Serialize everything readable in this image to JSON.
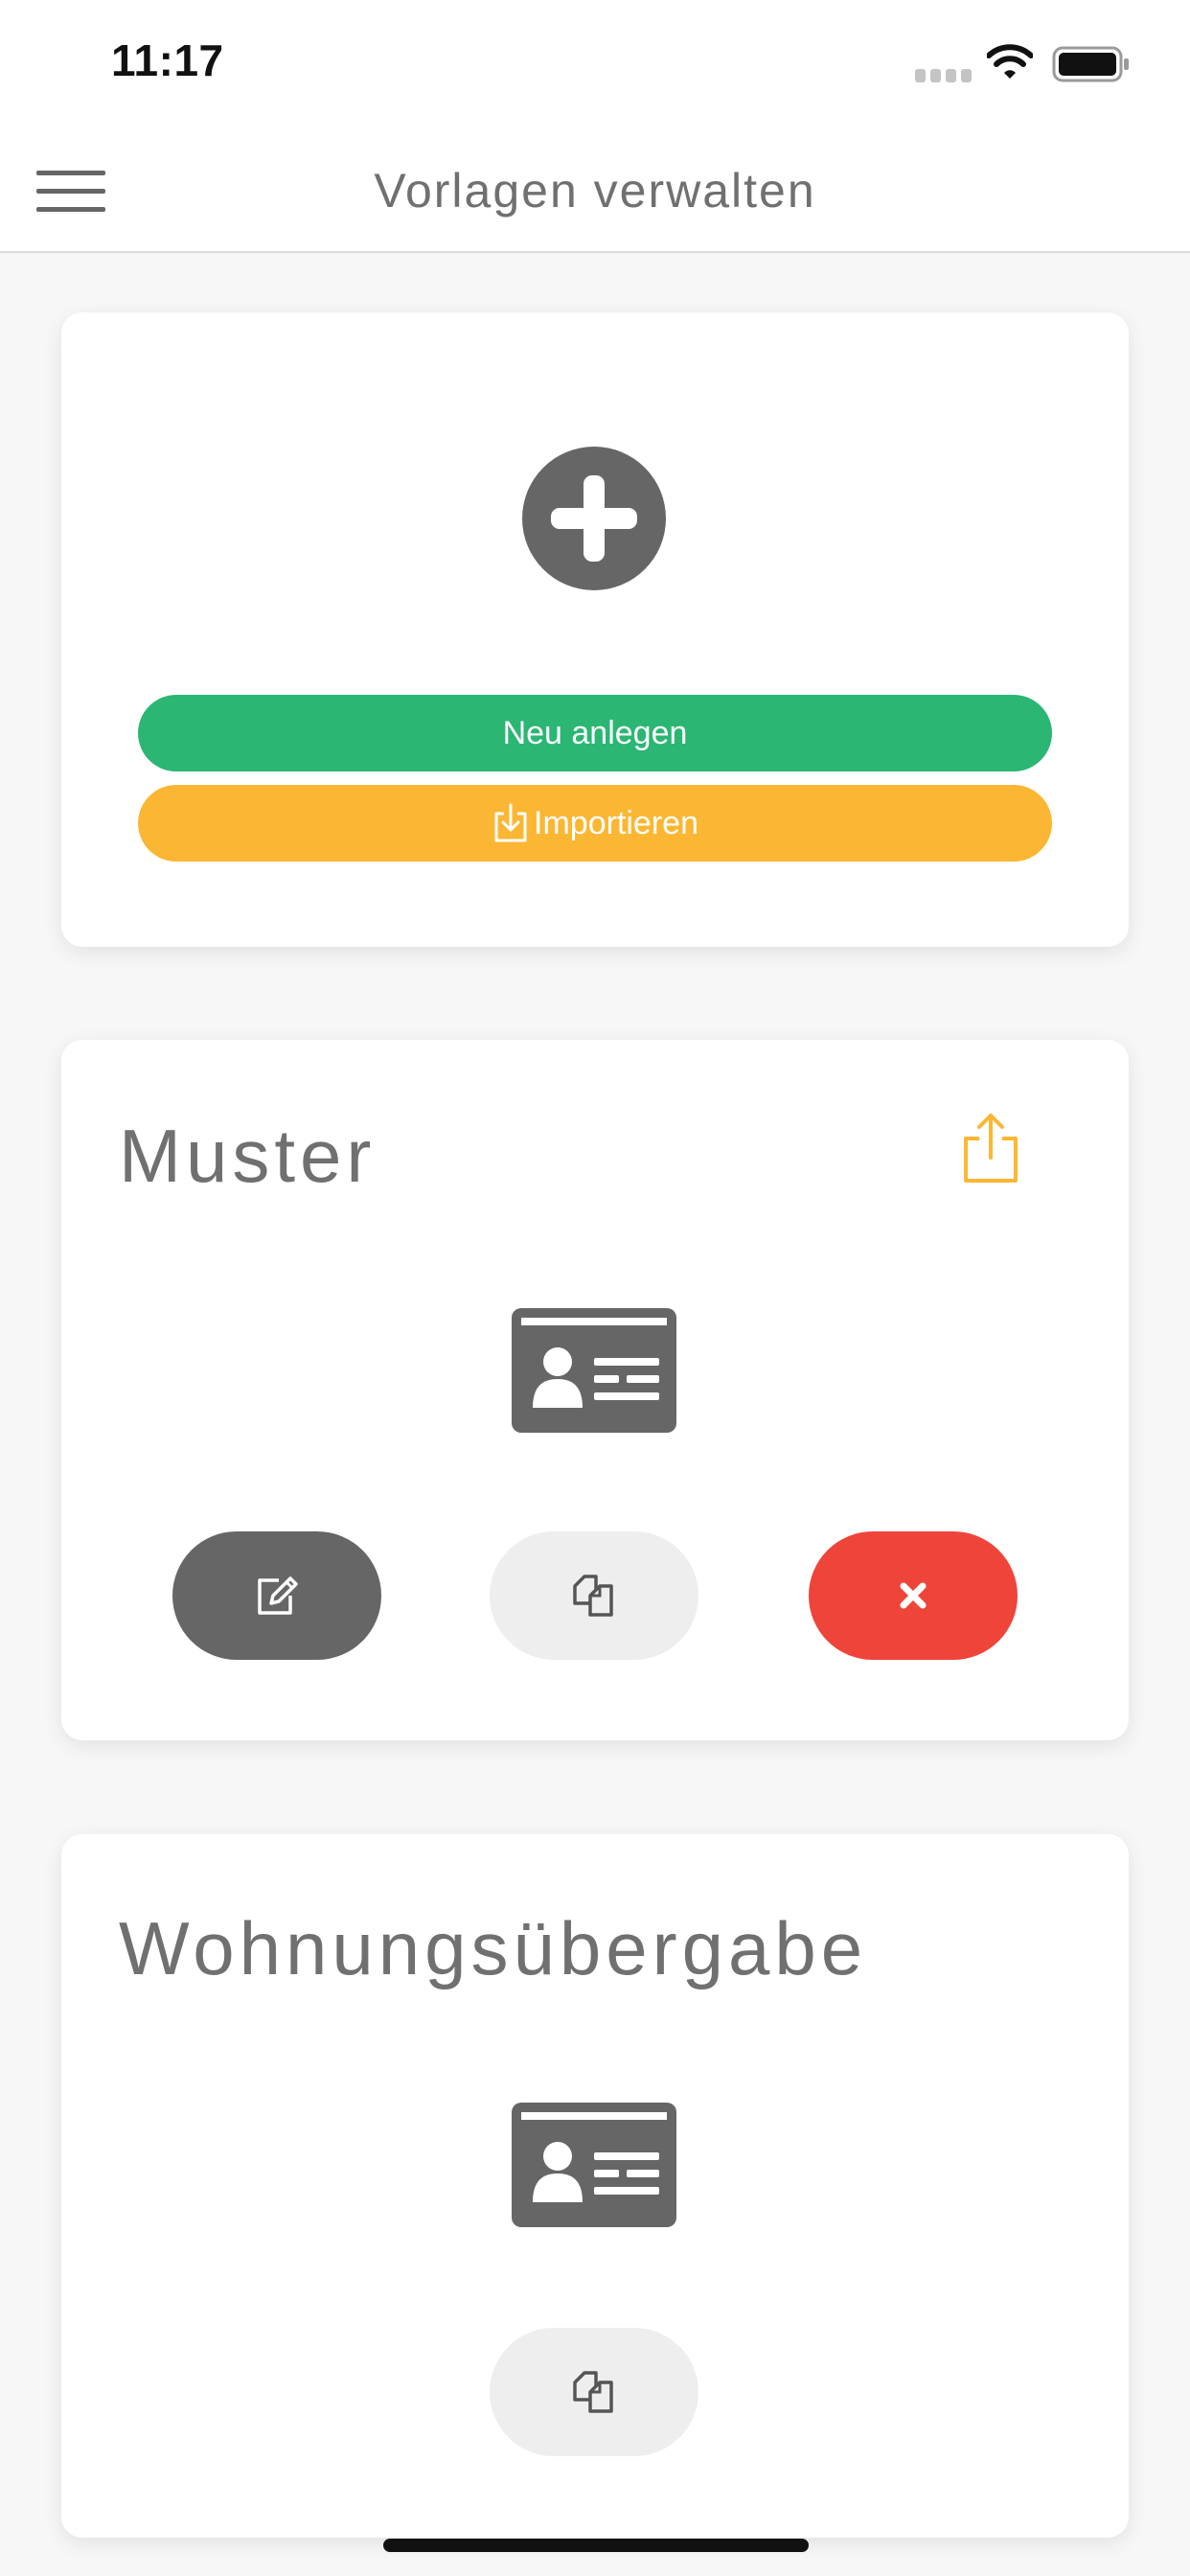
{
  "status_bar": {
    "time": "11:17"
  },
  "nav": {
    "title": "Vorlagen verwalten",
    "menu_icon": "hamburger-menu-icon"
  },
  "new_template": {
    "icon": "plus-circle-icon",
    "create_label": "Neu anlegen",
    "import_label": "Importieren",
    "import_icon": "import-download-icon"
  },
  "templates": [
    {
      "title": "Muster",
      "icon": "id-card-icon",
      "share_icon": "share-icon",
      "actions": [
        "edit-icon",
        "copy-icon",
        "delete-icon"
      ]
    },
    {
      "title": "Wohnungsübergabe",
      "icon": "id-card-icon",
      "actions": [
        "copy-icon"
      ]
    }
  ],
  "colors": {
    "accent_green": "#2bb673",
    "accent_yellow": "#fbb733",
    "danger_red": "#ef443a",
    "dark_gray": "#666666",
    "light_gray": "#eeeeee",
    "text_gray": "#707070",
    "background": "#f7f7f7"
  }
}
